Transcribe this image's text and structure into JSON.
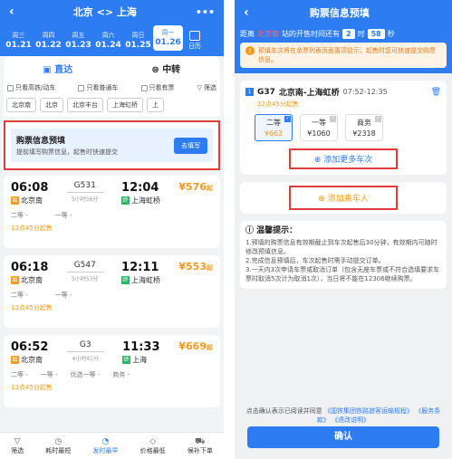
{
  "left": {
    "title": "北京 <> 上海",
    "more": "•••",
    "dates": [
      {
        "wk": "周三",
        "d": "01.21"
      },
      {
        "wk": "周四",
        "d": "01.22"
      },
      {
        "wk": "周五",
        "d": "01.23"
      },
      {
        "wk": "周六",
        "d": "01.24"
      },
      {
        "wk": "周日",
        "d": "01.25"
      },
      {
        "wk": "周一",
        "d": "01.26"
      }
    ],
    "calendar": "日历",
    "tabs": [
      "直达",
      "中转"
    ],
    "filters": [
      "只看高铁/动车",
      "只看普通车",
      "只看有票",
      "筛选"
    ],
    "stations": [
      "北京南",
      "北京",
      "北京丰台",
      "上海虹桥",
      "上"
    ],
    "promo": {
      "title": "购票信息预填",
      "sub": "提前填写购票信息，起售时快速提交",
      "btn": "去填写"
    },
    "trains": [
      {
        "dep": "06:08",
        "from": "北京南",
        "no": "G531",
        "dur": "5小时56分",
        "arr": "12:04",
        "to": "上海虹桥",
        "price": "¥576",
        "qi": "起",
        "seats": [
          "二等 -",
          "一等 -",
          ""
        ],
        "sale": "12点45分起售"
      },
      {
        "dep": "06:18",
        "from": "北京南",
        "no": "G547",
        "dur": "5小时53分",
        "arr": "12:11",
        "to": "上海虹桥",
        "price": "¥553",
        "qi": "起",
        "seats": [
          "二等 -",
          "一等 -",
          ""
        ],
        "sale": "12点45分起售"
      },
      {
        "dep": "06:52",
        "from": "北京南",
        "no": "G3",
        "dur": "4小时41分",
        "arr": "11:33",
        "to": "上海",
        "price": "¥669",
        "qi": "起",
        "seats": [
          "二等 -",
          "一等 -",
          "优选一等 -",
          "商务 -"
        ],
        "sale": "12点45分起售"
      }
    ],
    "nav": [
      {
        "icon": "▽",
        "label": "筛选"
      },
      {
        "icon": "◷",
        "label": "耗时最短"
      },
      {
        "icon": "◔",
        "label": "发时最早"
      },
      {
        "icon": "◇",
        "label": "价格最低"
      },
      {
        "icon": "⛟",
        "label": "候补下单"
      }
    ]
  },
  "right": {
    "title": "购票信息预填",
    "countdown": {
      "pre": "距离",
      "station": "北京南",
      "mid": "站的开售时间还有",
      "h": "2",
      "hu": "时",
      "m": "58",
      "mu": "秒"
    },
    "notice": "预填车次将在余票列表页面置顶显示，起售时您可快速提交购票信息。",
    "train": {
      "idx": "1",
      "no": "G37",
      "route": "北京南-上海虹桥",
      "time": "07:52-12:35",
      "sale": "12点45分起售"
    },
    "seats": [
      {
        "name": "二等",
        "price": "¥662",
        "on": true
      },
      {
        "name": "一等",
        "price": "¥1060",
        "on": false
      },
      {
        "name": "商务",
        "price": "¥2318",
        "on": false
      }
    ],
    "add_more": "添加更多车次",
    "add_passenger": "添加乘车人",
    "tips_title": "温馨提示：",
    "tips": [
      "1.预填的购票信息有效期截止到车次起售后30分钟，有效期内可随时修改预填信息。",
      "2.完成信息预填后，车次起售时需手动提交订单。",
      "3.一天内3次申请车票或取消订单（包含无座车票或不符合选填要求车票时取消5次计为取消1次），当日将不能在12306继续购票。"
    ],
    "agree_pre": "点击确认表示已阅读并同意",
    "agree_l1": "《国铁集团铁路旅客运输规程》",
    "agree_l2": "《服务条款》",
    "agree_l3": "《退改说明》",
    "confirm": "确认"
  }
}
